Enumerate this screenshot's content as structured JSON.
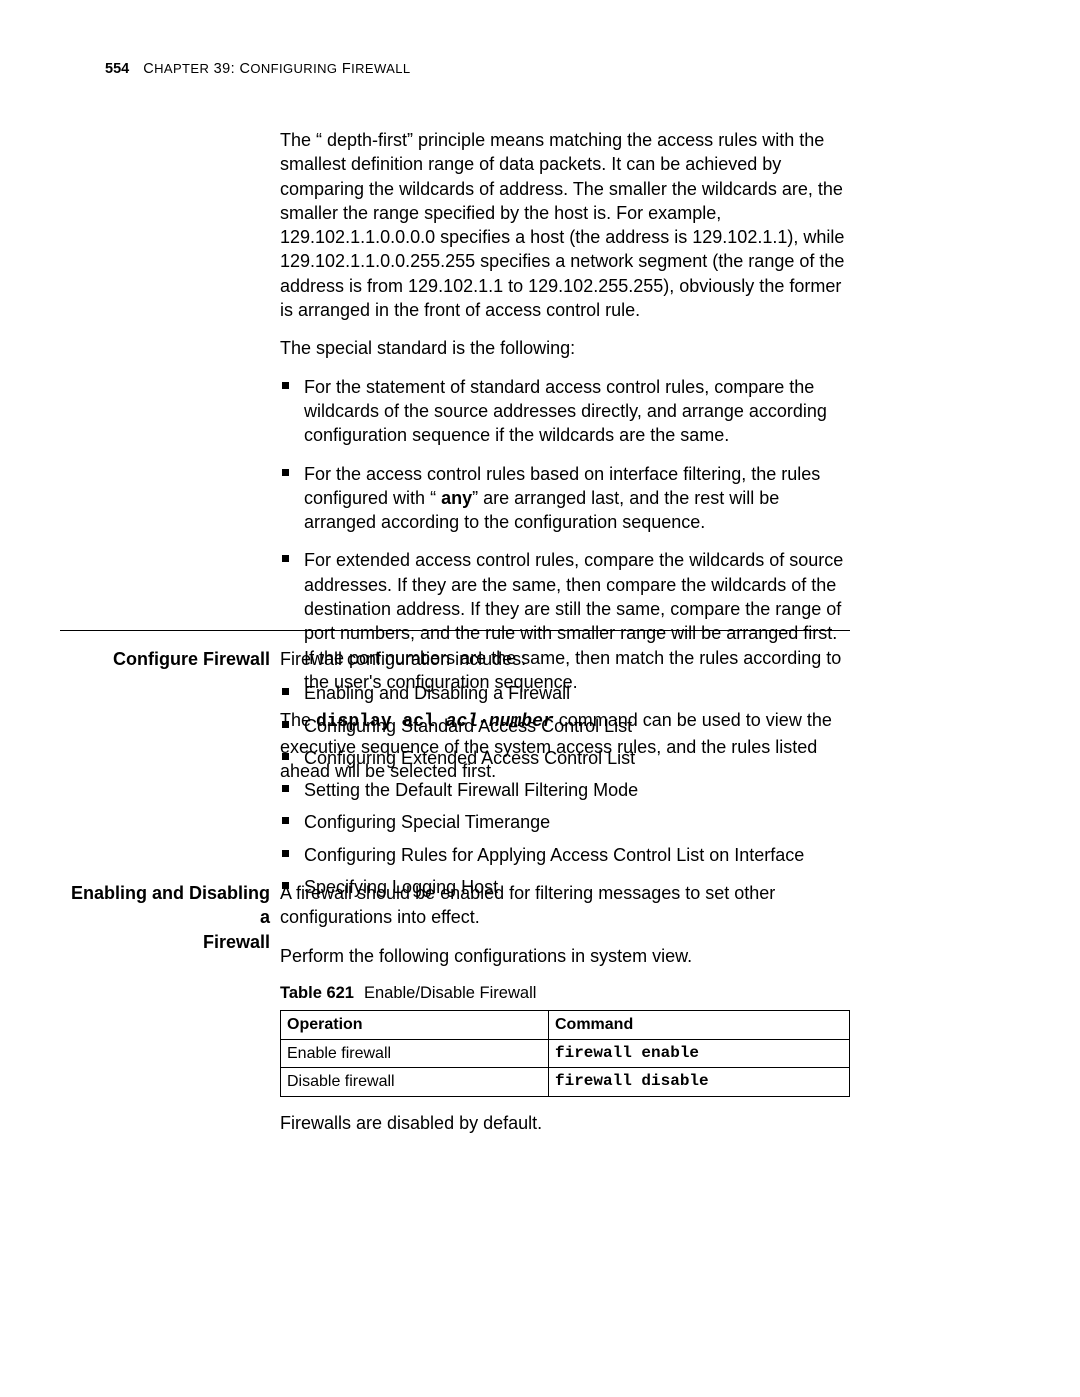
{
  "header": {
    "page_number": "554",
    "chapter_line_prefix": "C",
    "chapter_line_sc1": "HAPTER",
    "chapter_num": " 39: C",
    "chapter_line_sc2": "ONFIGURING",
    "chapter_line_sc3": " F",
    "chapter_line_sc4": "IREWALL"
  },
  "body": {
    "p_depth_first": "The “ depth-first”  principle means matching the access rules with the smallest definition range of data packets. It can be achieved by comparing the wildcards of address. The smaller the wildcards are, the smaller the range specified by the host is. For example, 129.102.1.1.0.0.0.0 specifies a host (the address is 129.102.1.1), while 129.102.1.1.0.0.255.255 specifies a network segment (the range of the address is from 129.102.1.1 to 129.102.255.255), obviously the former is arranged in the front of access control rule.",
    "p_special_std": "The special standard is the following:",
    "bullets1": {
      "b1": "For the statement of standard access control rules, compare the wildcards of the source addresses directly, and arrange according configuration sequence if the wildcards are the same.",
      "b2_a": "For the access control rules based on interface filtering, the rules configured with “ ",
      "b2_b_bold": "any",
      "b2_c": "” are arranged last, and the rest will be arranged according to the configuration sequence.",
      "b3": "For extended access control rules, compare the wildcards of source addresses. If they are the same, then compare the wildcards of the destination address. If they are still the same, compare the range of port numbers, and the rule with smaller range will be arranged first. If the port numbers are the same, then match the rules according to the user's configuration sequence."
    },
    "p_display_pre": "The ",
    "p_display_cmd": "display acl",
    "p_display_arg": " acl-number",
    "p_display_post": " command can be used to view the executive sequence of the system access rules, and the rules listed ahead will be selected first."
  },
  "section_configure": {
    "title": "Configure Firewall",
    "intro": "Firewall configuration includes:",
    "items": {
      "i1": "Enabling and Disabling a Firewall",
      "i2": "Configuring Standard Access Control List",
      "i3": "Configuring Extended Access Control List",
      "i4": "Setting the Default Firewall Filtering Mode",
      "i5": "Configuring Special Timerange",
      "i6": "Configuring Rules for Applying Access Control List on Interface",
      "i7": "Specifying Logging Host"
    }
  },
  "section_enable": {
    "title_line1": "Enabling and Disabling a",
    "title_line2": "Firewall",
    "p1": "A firewall should be enabled for filtering messages to set other configurations into effect.",
    "p2": "Perform the following configurations in system view.",
    "table_label": "Table 621",
    "table_caption": "Enable/Disable Firewall",
    "th_operation": "Operation",
    "th_command": "Command",
    "r1_op": "Enable firewall",
    "r1_cmd": "firewall enable",
    "r2_op": "Disable firewall",
    "r2_cmd": "firewall disable",
    "p_after": "Firewalls are disabled by default."
  }
}
